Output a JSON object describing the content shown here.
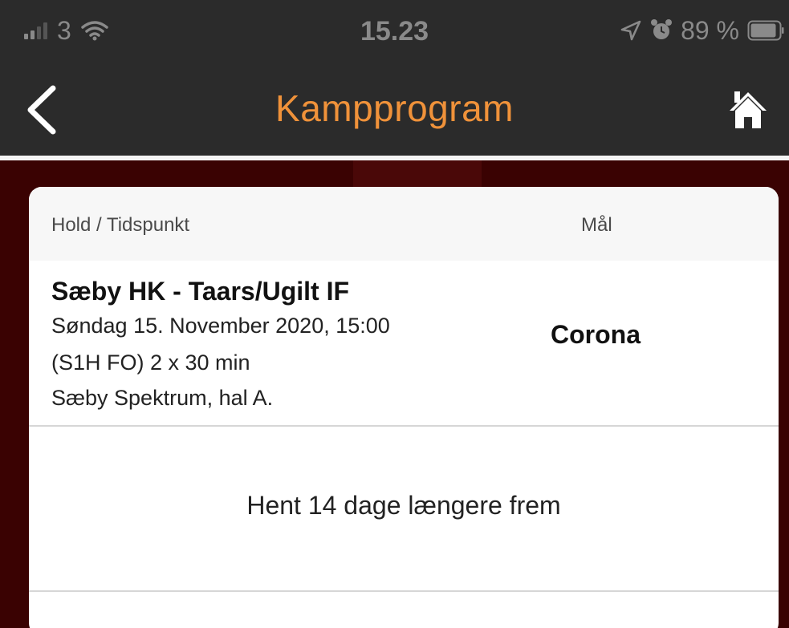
{
  "status_bar": {
    "carrier": "3",
    "time": "15.23",
    "battery": "89 %",
    "icons": [
      "signal-icon",
      "wifi-icon",
      "location-arrow-icon",
      "alarm-icon",
      "battery-icon"
    ]
  },
  "nav": {
    "title": "Kampprogram",
    "back_icon": "chevron-left-icon",
    "home_icon": "home-icon",
    "title_color": "#f0923a"
  },
  "table": {
    "headers": [
      "Hold / Tidspunkt",
      "Mål"
    ],
    "matches": [
      {
        "teams": "Sæby HK - Taars/Ugilt IF",
        "datetime": "Søndag 15. November 2020, 15:00",
        "format": "(S1H FO) 2 x 30 min",
        "venue": "Sæby Spektrum, hal A.",
        "result": "Corona"
      }
    ],
    "load_more": "Hent 14 dage længere frem"
  }
}
